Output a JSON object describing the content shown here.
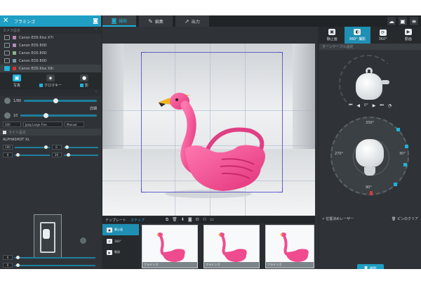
{
  "app": {
    "panel_title": "フラミンゴ"
  },
  "tabs": [
    {
      "label": "撮影",
      "icon": "camera-icon"
    },
    {
      "label": "編集",
      "icon": "edit-icon"
    },
    {
      "label": "出力",
      "icon": "export-icon"
    }
  ],
  "left": {
    "camera_section": "カメラ設定",
    "cameras": [
      {
        "name": "Canon EOS Kiss X7i",
        "color": "#b686b1"
      },
      {
        "name": "Canon EOS 80D",
        "color": "#b08bbc"
      },
      {
        "name": "Canon EOS 80D",
        "color": "#8ab48e"
      },
      {
        "name": "Canon EOS 80D",
        "color": "#7a9aaa"
      },
      {
        "name": "Canon EOS Kiss X9i",
        "color": "#d6352f"
      }
    ],
    "modes": [
      {
        "label": "写真",
        "icon": "photo-icon"
      },
      {
        "label": "クロマキー",
        "icon": "chroma-icon"
      },
      {
        "label": "影",
        "icon": "shadow-icon"
      }
    ],
    "slider_values": [
      "1/80",
      "10"
    ],
    "slider_end_label": "詳細",
    "dropdowns": [
      "200",
      "Jpeg Large Fine",
      "Manual"
    ],
    "light_section": "ライト設定",
    "light_name": "ALPHASHOT XL",
    "mini_values": [
      "100",
      "0",
      "0",
      "20",
      "0"
    ]
  },
  "center": {
    "template_tab": "テンプレート",
    "active_tab": "ステップ",
    "nav_items": [
      {
        "label": "静止画",
        "icon": "still-icon"
      },
      {
        "label": "360°",
        "icon": "360-icon"
      },
      {
        "label": "動画",
        "icon": "video-icon"
      }
    ],
    "thumb_caption": "フラミンゴ"
  },
  "right": {
    "tabs": [
      {
        "label": "静止画",
        "icon": "still-icon"
      },
      {
        "label": "360° 撮影",
        "icon": "orbit-icon"
      },
      {
        "label": "360°",
        "icon": "360-icon"
      },
      {
        "label": "動画",
        "icon": "video-icon"
      }
    ],
    "section": "ターンテーブル設定",
    "tilt_degree": "0°",
    "dial_labels": [
      "330°",
      "30°",
      "270°",
      "90°"
    ],
    "laser_label": "位置決めレーザー",
    "clear_label": "ピンのクリア",
    "shoot_label": "撮影"
  },
  "colors": {
    "accent": "#1fb1d9",
    "crop": "#5a5ac6",
    "pink": "#f04b8e"
  }
}
